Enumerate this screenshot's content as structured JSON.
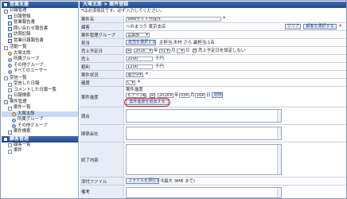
{
  "sidebar": {
    "sec1": "営業支援",
    "s1_daily": "日報管理",
    "s1_edit": "日報登録",
    "s1_sales": "営業報告書",
    "s1_inquiry": "問い合わせ報告書",
    "s1_visit": "訪問記録",
    "s1_dtask": "営業日報報告書",
    "s1_activity": "活動一覧",
    "s1_self": "大塚太郎",
    "s1_group": "所属グループ",
    "s1_other": "その他グループ",
    "s1_alluser": "すべてのユーザー",
    "s1_lists": "受信一覧",
    "s1_comment": "受信した日報",
    "s1_cmt2": "コメントした日報一覧",
    "s1_search": "日報検索",
    "s2_case": "案件管理",
    "s2_list": "案件一覧",
    "s2_self": "大塚太郎",
    "s2_group": "所属グループ",
    "s2_other": "その他グループ",
    "s2_search": "案件検索",
    "sec3": "顧客管理",
    "s3_list": "顧客一覧",
    "s3_case": "案件"
  },
  "main": {
    "title": "大塚太郎 > 案件登録",
    "note_mark": "*",
    "note_text": "は必須項目です。必ず入力してください。"
  },
  "form": {
    "name_label": "案件名",
    "name_value": "Webサイト作成件",
    "client_label": "顧客",
    "client_value": "へのまつり 東京支店",
    "clear_btn": "クリア",
    "client_select_btn": "顧客を選択する",
    "group_label": "案件管理グループ",
    "group_value": "営業部",
    "owner_label": "担当",
    "owner_btn": "担当を選択する",
    "owner_text": "主担当:木村 さら 副担当:1名",
    "date_label": "売上予定日",
    "date_value": "2016年 1月",
    "date_year": "2016",
    "date_month": "01",
    "date_year_unit": "年",
    "date_month_unit": "月",
    "date_day_unit": "日",
    "no_date_label": "売上予定日を設定しない",
    "sales_label": "売上",
    "sales_value": "2000",
    "sales_unit": "千円",
    "profit_label": "粗利",
    "profit_value": "1200",
    "profit_unit": "千円",
    "status_label": "案件状況",
    "status_value": "進行中",
    "rank_label": "確度",
    "rank_value": "C",
    "progress_label": "案件進度",
    "progress_head": "案件進度",
    "progress_item": "ヒアリング",
    "progress_year": "2016",
    "progress_month": "03",
    "progress_day": "16",
    "progress_delete": "削除",
    "add_progress_btn": "案件進度を追加する",
    "competitor_label": "競合",
    "related_label": "関係会社",
    "reason_label": "終了内容",
    "attach_label": "添付ファイル",
    "attach_btn": "ファイルを添付する",
    "attach_note": "(最大 3MB まで)",
    "remarks_label": "備考"
  },
  "colors": {
    "accent_blue": "#22488e",
    "label_bg": "#e7edf7",
    "required_red": "#dd0000",
    "highlight_circle": "#e51c1c"
  }
}
